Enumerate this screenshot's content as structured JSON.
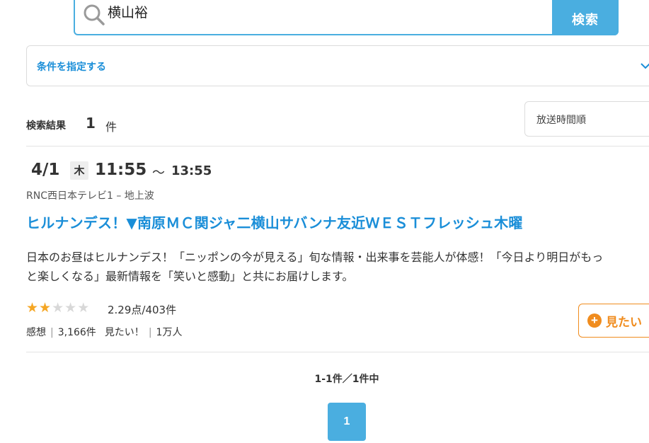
{
  "search": {
    "query": "横山裕",
    "button_label": "検索"
  },
  "filter": {
    "label": "条件を指定する"
  },
  "results": {
    "label": "検索結果",
    "count": "1",
    "unit": "件",
    "sort_label": "放送時間順"
  },
  "program": {
    "date": "4/1",
    "weekday": "木",
    "start_time": "11:55",
    "separator": "～",
    "end_time": "13:55",
    "channel": "RNC西日本テレビ1 – 地上波",
    "title": "ヒルナンデス！▼南原ＭＣ関ジャ二横山サバンナ友近ＷＥＳＴフレッシュ木曜",
    "description_line1": "日本のお昼はヒルナンデス！「ニッポンの今が見える」旬な情報・出来事を芸能人が体感！「今日より明日がもっ",
    "description_line2": "と楽しくなる」最新情報を「笑いと感動」と共にお届けします。",
    "rating": 2.29,
    "stars_filled": 2,
    "stars_total": 5,
    "rating_text": "2.29点/403件",
    "impressions_label": "感想",
    "impressions_value": "3,166件",
    "want_label": "見たい！",
    "want_value": "1万人",
    "want_button_label": "見たい"
  },
  "pagination": {
    "summary": "1-1件／1件中",
    "current_page": "1"
  },
  "colors": {
    "accent": "#4aaee0",
    "link": "#1a8ed8",
    "star": "#f5a623",
    "want": "#f08c1e"
  }
}
